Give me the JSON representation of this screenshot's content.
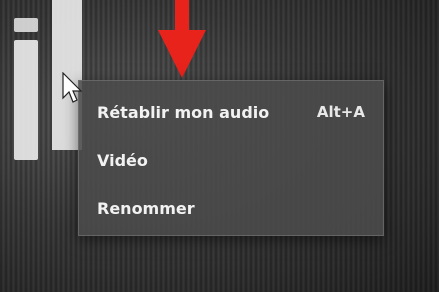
{
  "context_menu": {
    "items": [
      {
        "label": "Rétablir mon audio",
        "shortcut": "Alt+A"
      },
      {
        "label": "Vidéo",
        "shortcut": ""
      },
      {
        "label": "Renommer",
        "shortcut": ""
      }
    ]
  },
  "colors": {
    "annotation_arrow": "#e8231b",
    "menu_background": "#4b4b4b",
    "menu_text": "#f2f2f2"
  },
  "icons": {
    "cursor": "mouse-pointer-icon",
    "annotation": "down-arrow-icon"
  }
}
